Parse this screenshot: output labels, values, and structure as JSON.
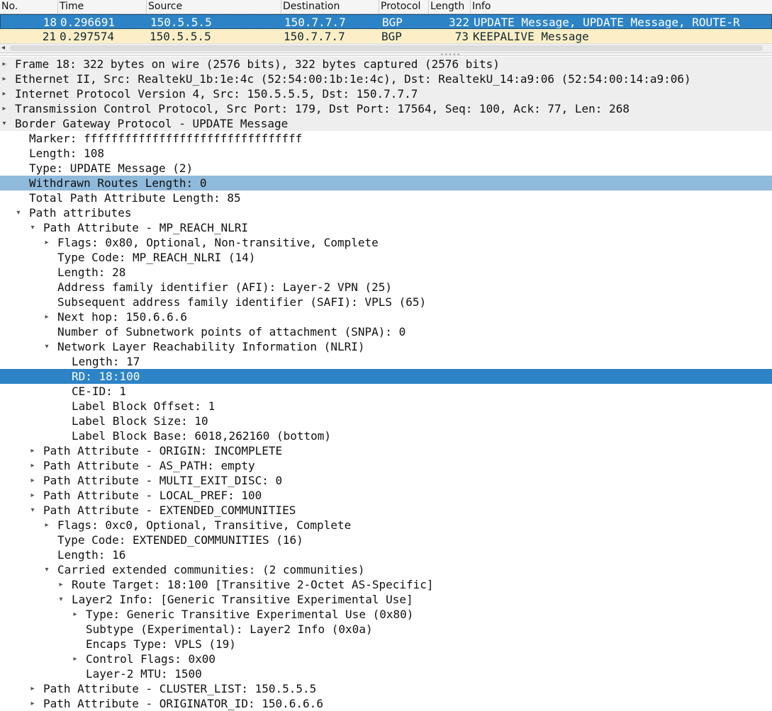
{
  "packet_list": {
    "columns": [
      "No.",
      "Time",
      "Source",
      "Destination",
      "Protocol",
      "Length",
      "Info"
    ],
    "rows": [
      {
        "no": "18",
        "time": "0.296691",
        "source": "150.5.5.5",
        "destination": "150.7.7.7",
        "protocol": "BGP",
        "length": "322",
        "info": "UPDATE Message, UPDATE Message, ROUTE-R",
        "state": "selected"
      },
      {
        "no": "21",
        "time": "0.297574",
        "source": "150.5.5.5",
        "destination": "150.7.7.7",
        "protocol": "BGP",
        "length": "73",
        "info": "KEEPALIVE Message",
        "state": "keepalive"
      }
    ],
    "colors": {
      "selected_bg": "#2c83c6",
      "keepalive_bg": "#fcefc7"
    }
  },
  "details": {
    "rows": [
      {
        "level": 0,
        "toggle": "collapsed",
        "text": "Frame 18: 322 bytes on wire (2576 bits), 322 bytes captured (2576 bits)"
      },
      {
        "level": 0,
        "toggle": "collapsed",
        "text": "Ethernet II, Src: RealtekU_1b:1e:4c (52:54:00:1b:1e:4c), Dst: RealtekU_14:a9:06 (52:54:00:14:a9:06)"
      },
      {
        "level": 0,
        "toggle": "collapsed",
        "text": "Internet Protocol Version 4, Src: 150.5.5.5, Dst: 150.7.7.7"
      },
      {
        "level": 0,
        "toggle": "collapsed",
        "text": "Transmission Control Protocol, Src Port: 179, Dst Port: 17564, Seq: 100, Ack: 77, Len: 268"
      },
      {
        "level": 0,
        "toggle": "expanded",
        "text": "Border Gateway Protocol - UPDATE Message"
      },
      {
        "level": 1,
        "toggle": "none",
        "text": "Marker: ffffffffffffffffffffffffffffffff"
      },
      {
        "level": 1,
        "toggle": "none",
        "text": "Length: 108"
      },
      {
        "level": 1,
        "toggle": "none",
        "text": "Type: UPDATE Message (2)"
      },
      {
        "level": 1,
        "toggle": "none",
        "text": "Withdrawn Routes Length: 0",
        "state": "highlight"
      },
      {
        "level": 1,
        "toggle": "none",
        "text": "Total Path Attribute Length: 85"
      },
      {
        "level": 1,
        "toggle": "expanded",
        "text": "Path attributes"
      },
      {
        "level": 2,
        "toggle": "expanded",
        "text": "Path Attribute - MP_REACH_NLRI"
      },
      {
        "level": 3,
        "toggle": "collapsed",
        "text": "Flags: 0x80, Optional, Non-transitive, Complete"
      },
      {
        "level": 3,
        "toggle": "none",
        "text": "Type Code: MP_REACH_NLRI (14)"
      },
      {
        "level": 3,
        "toggle": "none",
        "text": "Length: 28"
      },
      {
        "level": 3,
        "toggle": "none",
        "text": "Address family identifier (AFI): Layer-2 VPN (25)"
      },
      {
        "level": 3,
        "toggle": "none",
        "text": "Subsequent address family identifier (SAFI): VPLS (65)"
      },
      {
        "level": 3,
        "toggle": "collapsed",
        "text": "Next hop: 150.6.6.6"
      },
      {
        "level": 3,
        "toggle": "none",
        "text": "Number of Subnetwork points of attachment (SNPA): 0"
      },
      {
        "level": 3,
        "toggle": "expanded",
        "text": "Network Layer Reachability Information (NLRI)"
      },
      {
        "level": 4,
        "toggle": "none",
        "text": "Length: 17"
      },
      {
        "level": 4,
        "toggle": "none",
        "text": "RD: 18:100",
        "state": "selected"
      },
      {
        "level": 4,
        "toggle": "none",
        "text": "CE-ID: 1"
      },
      {
        "level": 4,
        "toggle": "none",
        "text": "Label Block Offset: 1"
      },
      {
        "level": 4,
        "toggle": "none",
        "text": "Label Block Size: 10"
      },
      {
        "level": 4,
        "toggle": "none",
        "text": "Label Block Base: 6018,262160 (bottom)"
      },
      {
        "level": 2,
        "toggle": "collapsed",
        "text": "Path Attribute - ORIGIN: INCOMPLETE"
      },
      {
        "level": 2,
        "toggle": "collapsed",
        "text": "Path Attribute - AS_PATH: empty"
      },
      {
        "level": 2,
        "toggle": "collapsed",
        "text": "Path Attribute - MULTI_EXIT_DISC: 0"
      },
      {
        "level": 2,
        "toggle": "collapsed",
        "text": "Path Attribute - LOCAL_PREF: 100"
      },
      {
        "level": 2,
        "toggle": "expanded",
        "text": "Path Attribute - EXTENDED_COMMUNITIES"
      },
      {
        "level": 3,
        "toggle": "collapsed",
        "text": "Flags: 0xc0, Optional, Transitive, Complete"
      },
      {
        "level": 3,
        "toggle": "none",
        "text": "Type Code: EXTENDED_COMMUNITIES (16)"
      },
      {
        "level": 3,
        "toggle": "none",
        "text": "Length: 16"
      },
      {
        "level": 3,
        "toggle": "expanded",
        "text": "Carried extended communities: (2 communities)"
      },
      {
        "level": 4,
        "toggle": "collapsed",
        "text": "Route Target: 18:100 [Transitive 2-Octet AS-Specific]"
      },
      {
        "level": 4,
        "toggle": "expanded",
        "text": "Layer2 Info: [Generic Transitive Experimental Use]"
      },
      {
        "level": 5,
        "toggle": "collapsed",
        "text": "Type: Generic Transitive Experimental Use (0x80)"
      },
      {
        "level": 5,
        "toggle": "none",
        "text": "Subtype (Experimental): Layer2 Info (0x0a)"
      },
      {
        "level": 5,
        "toggle": "none",
        "text": "Encaps Type: VPLS (19)"
      },
      {
        "level": 5,
        "toggle": "collapsed",
        "text": "Control Flags: 0x00"
      },
      {
        "level": 5,
        "toggle": "none",
        "text": "Layer-2 MTU: 1500"
      },
      {
        "level": 2,
        "toggle": "collapsed",
        "text": "Path Attribute - CLUSTER_LIST: 150.5.5.5"
      },
      {
        "level": 2,
        "toggle": "collapsed",
        "text": "Path Attribute - ORIGINATOR_ID: 150.6.6.6"
      }
    ],
    "colors": {
      "highlight_bg": "#8fbadb",
      "selected_bg": "#2c83c6",
      "top_level_bg": "#eeeeee"
    }
  }
}
